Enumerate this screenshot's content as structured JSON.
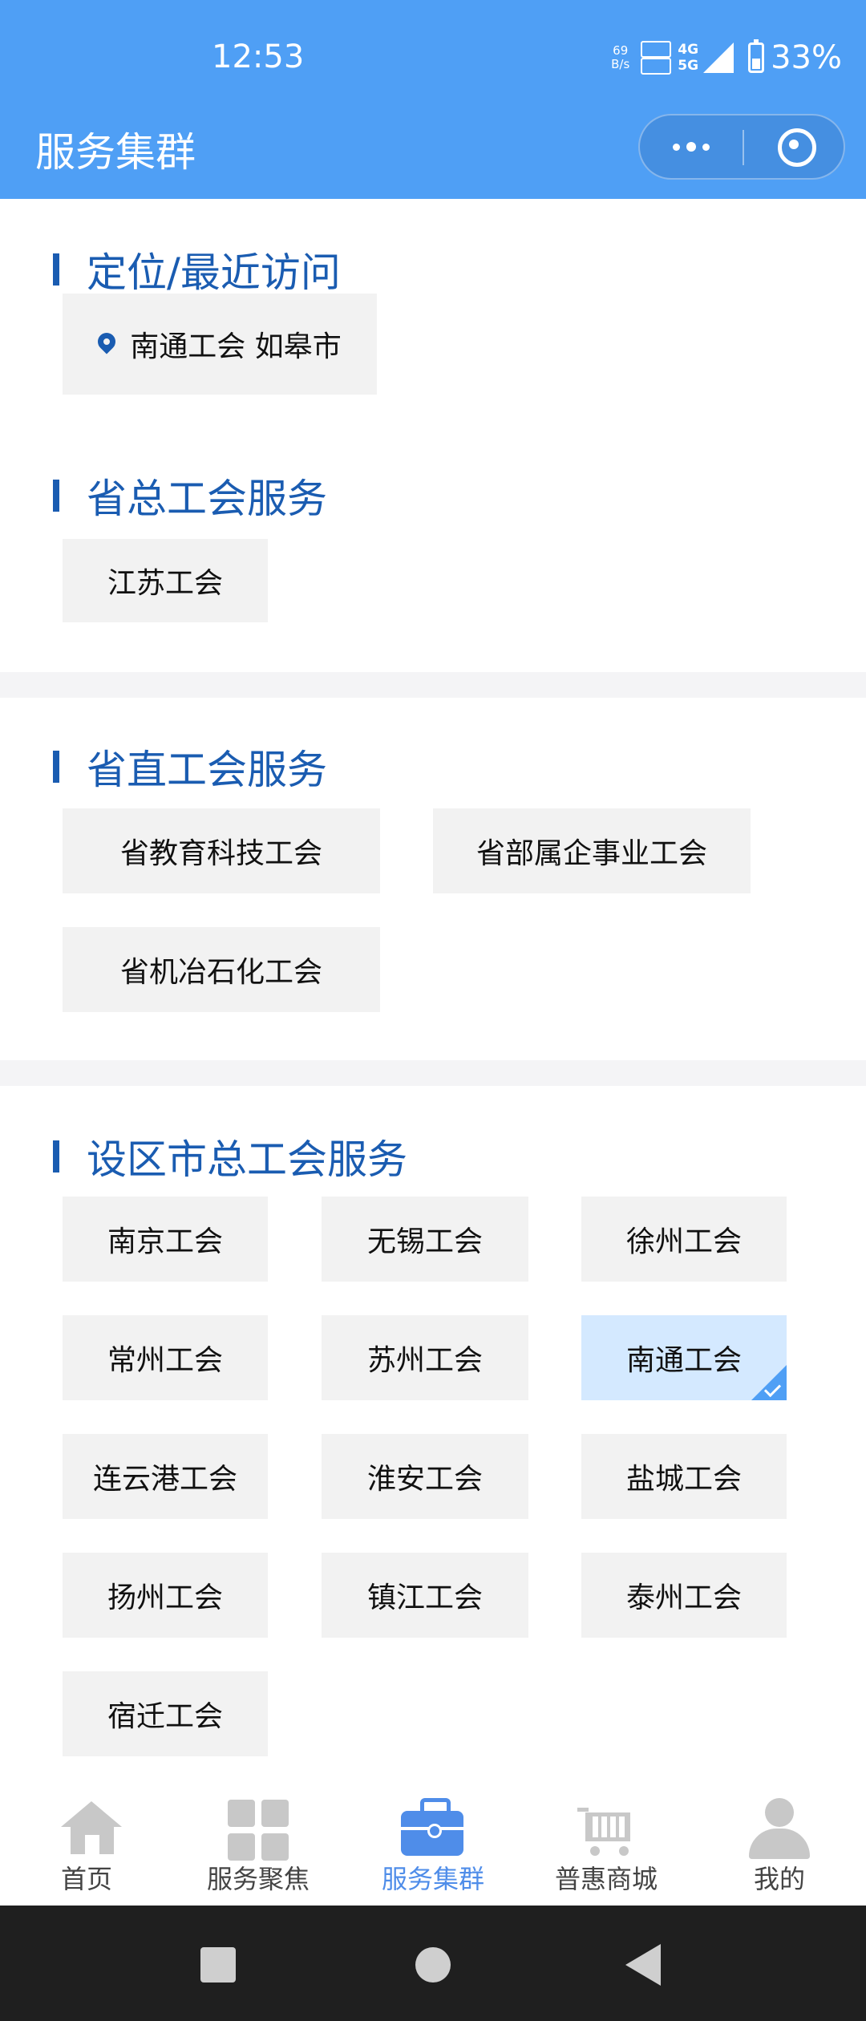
{
  "status_bar": {
    "time": "12:53",
    "net_speed_value": "69",
    "net_speed_unit": "B/s",
    "network_4g": "4G",
    "network_5g": "5G",
    "battery": "33%"
  },
  "header": {
    "title": "服务集群",
    "more_icon": "more-dots-icon",
    "close_icon": "target-icon"
  },
  "sections": {
    "recent": {
      "title": "定位/最近访问",
      "location_icon": "location-pin-icon",
      "items": [
        "南通工会 如皋市"
      ]
    },
    "provincial": {
      "title": "省总工会服务",
      "items": [
        "江苏工会"
      ]
    },
    "province_direct": {
      "title": "省直工会服务",
      "items": [
        "省教育科技工会",
        "省部属企事业工会",
        "省机冶石化工会"
      ]
    },
    "city": {
      "title": "设区市总工会服务",
      "items": [
        "南京工会",
        "无锡工会",
        "徐州工会",
        "常州工会",
        "苏州工会",
        "南通工会",
        "连云港工会",
        "淮安工会",
        "盐城工会",
        "扬州工会",
        "镇江工会",
        "泰州工会",
        "宿迁工会"
      ],
      "selected": "南通工会"
    }
  },
  "tabbar": {
    "items": [
      {
        "label": "首页",
        "icon": "home-icon"
      },
      {
        "label": "服务聚焦",
        "icon": "grid-icon"
      },
      {
        "label": "服务集群",
        "icon": "briefcase-icon"
      },
      {
        "label": "普惠商城",
        "icon": "cart-icon"
      },
      {
        "label": "我的",
        "icon": "user-icon"
      }
    ],
    "active": "服务集群"
  },
  "colors": {
    "header_bg": "#4f9ff5",
    "section_title": "#1a5cb1",
    "active_tab": "#4f8de9",
    "chip_bg": "#f2f2f2",
    "chip_selected_bg": "#d4e9ff"
  }
}
